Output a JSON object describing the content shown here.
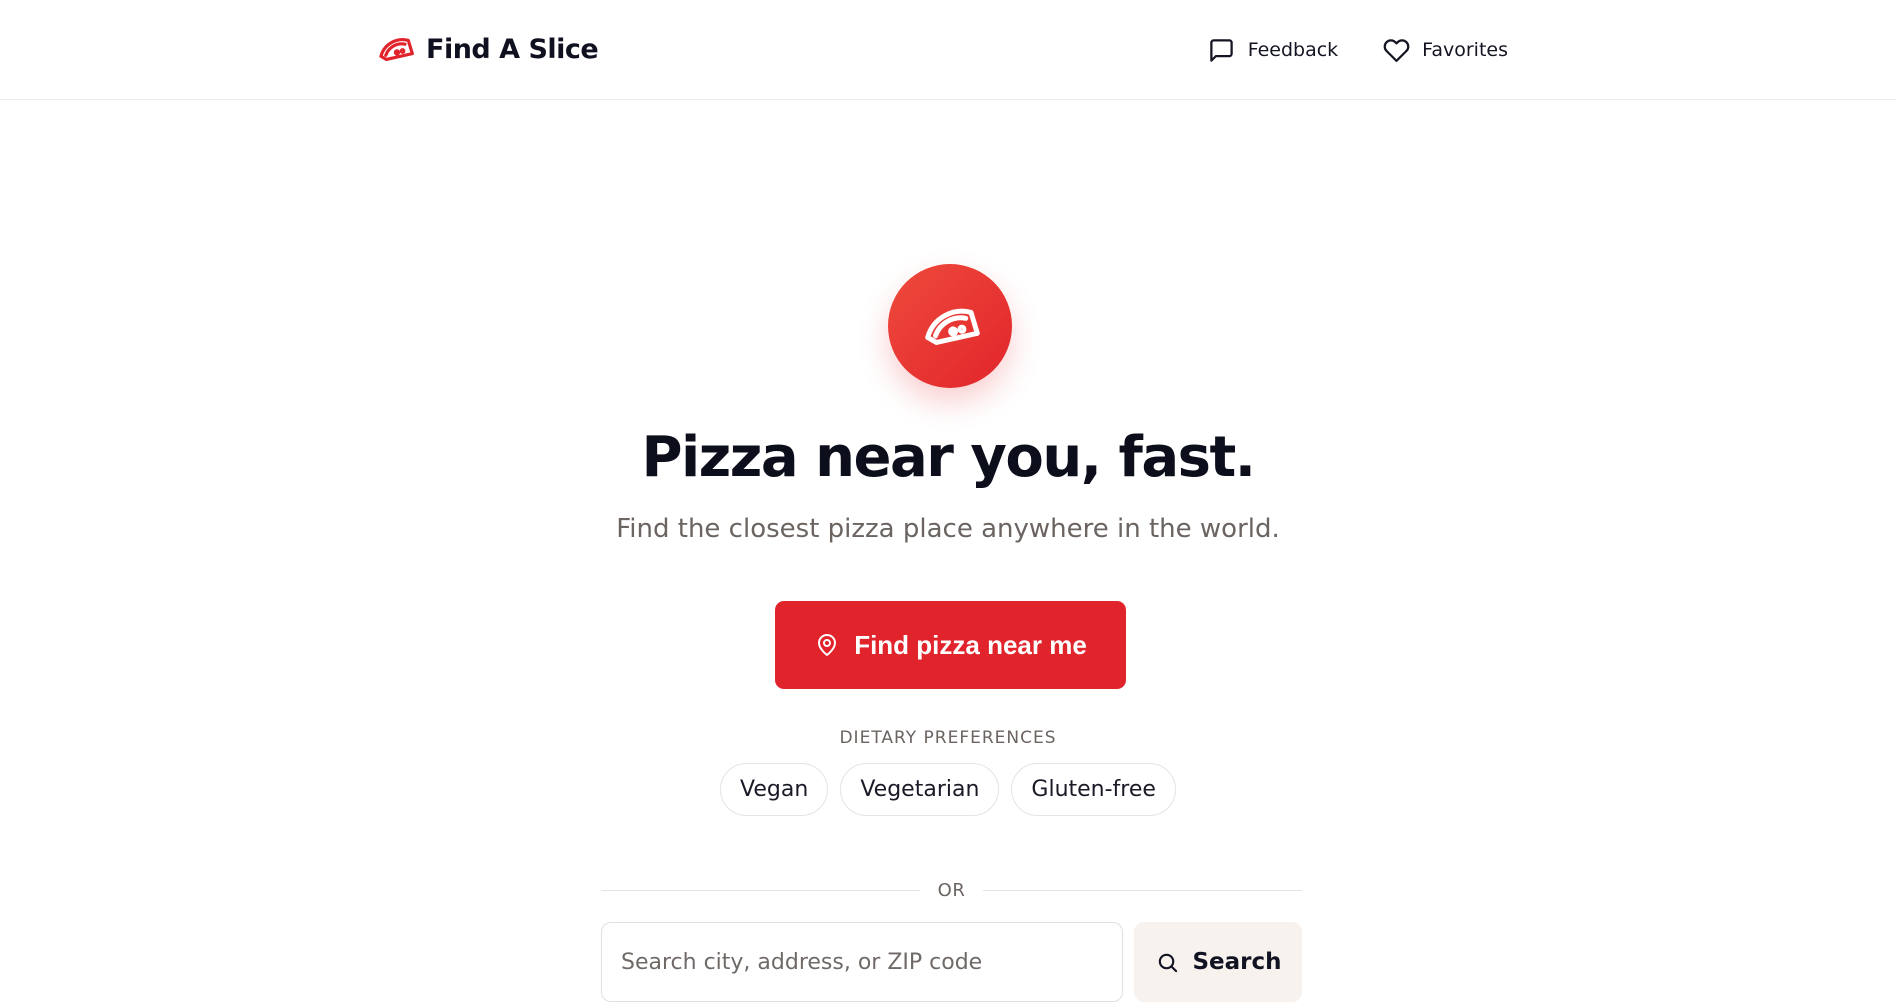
{
  "header": {
    "brand_name": "Find A Slice",
    "brand_icon": "pizza-slice-icon",
    "nav": {
      "feedback_label": "Feedback",
      "feedback_icon": "message-square-icon",
      "favorites_label": "Favorites",
      "favorites_icon": "heart-icon"
    }
  },
  "hero": {
    "icon": "pizza-slice-icon",
    "title": "Pizza near you, fast.",
    "subtitle": "Find the closest pizza place anywhere in the world."
  },
  "cta": {
    "label": "Find pizza near me",
    "icon": "map-pin-icon"
  },
  "dietary": {
    "label": "DIETARY PREFERENCES",
    "options": [
      "Vegan",
      "Vegetarian",
      "Gluten-free"
    ]
  },
  "divider": {
    "text": "OR"
  },
  "search": {
    "placeholder": "Search city, address, or ZIP code",
    "value": "",
    "button_label": "Search",
    "button_icon": "search-icon"
  },
  "colors": {
    "accent": "#e1232b",
    "text_primary": "#0d0e1c",
    "text_muted": "#6b6461",
    "border": "#e6e3e1",
    "search_button_bg": "#f7f2ee"
  }
}
